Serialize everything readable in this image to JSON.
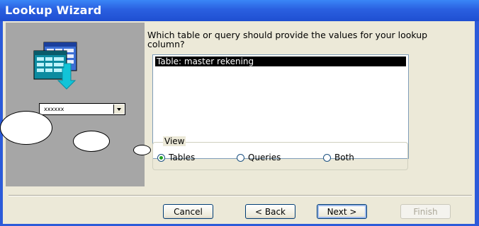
{
  "window": {
    "title": "Lookup Wizard"
  },
  "prompt": {
    "text": "Which table or query should provide the values for your lookup column?"
  },
  "list": {
    "items": [
      "Table: master rekening"
    ],
    "selected_index": 0
  },
  "view": {
    "legend": "View",
    "options": [
      {
        "label": "Tables",
        "selected": true
      },
      {
        "label": "Queries",
        "selected": false
      },
      {
        "label": "Both",
        "selected": false
      }
    ]
  },
  "illustration": {
    "combo_text": "xxxxxx"
  },
  "buttons": {
    "cancel": "Cancel",
    "back": "< Back",
    "next": "Next >",
    "finish": "Finish"
  },
  "colors": {
    "title_bar": "#2a5fe0",
    "dialog_bg": "#ece9d8",
    "left_panel": "#a6a6a6",
    "selection": "#000000",
    "radio_dot": "#21a121"
  }
}
